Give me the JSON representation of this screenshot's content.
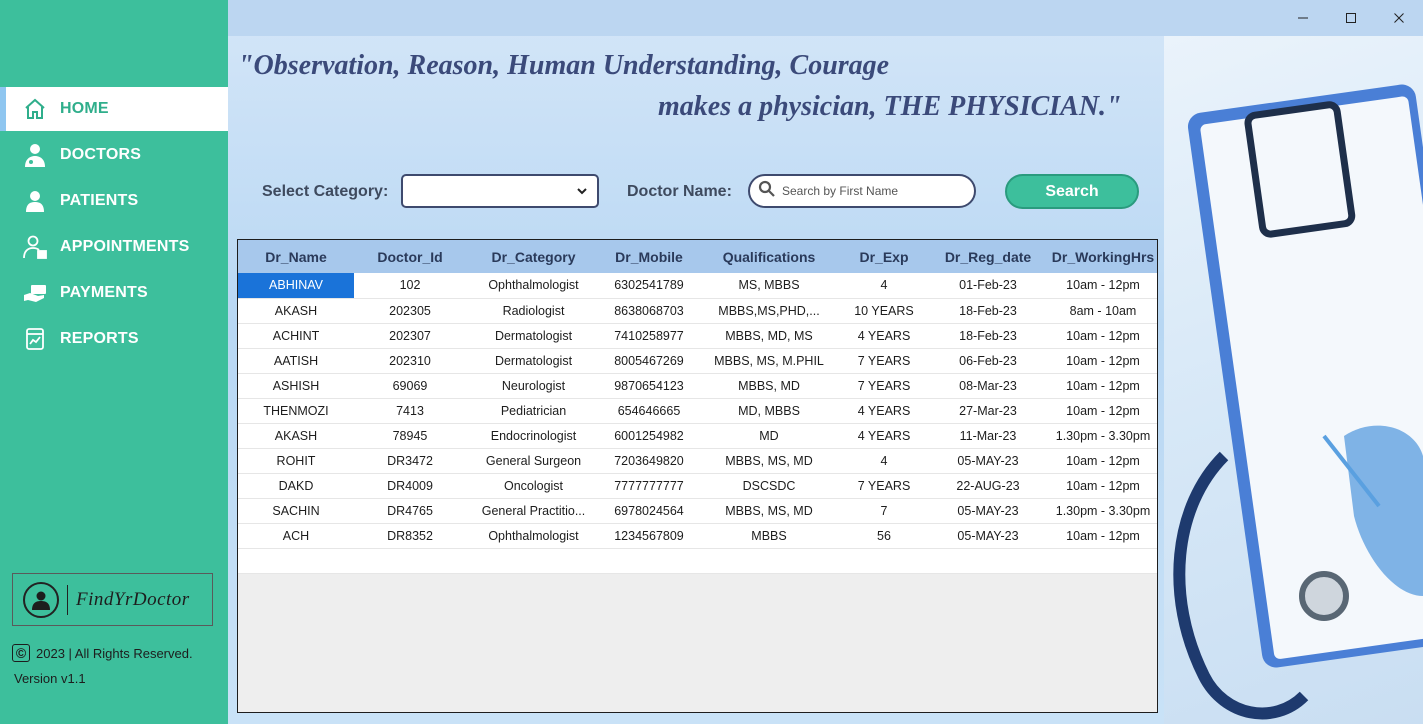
{
  "window": {
    "minimize_icon": "minimize-icon",
    "maximize_icon": "maximize-icon",
    "close_icon": "close-icon"
  },
  "sidebar": {
    "items": [
      {
        "label": "HOME",
        "icon": "home-icon",
        "active": true
      },
      {
        "label": "DOCTORS",
        "icon": "doctor-icon",
        "active": false
      },
      {
        "label": "PATIENTS",
        "icon": "patient-icon",
        "active": false
      },
      {
        "label": "APPOINTMENTS",
        "icon": "appointment-icon",
        "active": false
      },
      {
        "label": "PAYMENTS",
        "icon": "payment-icon",
        "active": false
      },
      {
        "label": "REPORTS",
        "icon": "report-icon",
        "active": false
      }
    ],
    "brand": "FindYrDoctor",
    "copyright": "2023 | All Rights Reserved.",
    "version": "Version v1.1"
  },
  "header": {
    "quote_line1": "\"Observation, Reason, Human Understanding, Courage",
    "quote_line2": "makes a physician, THE PHYSICIAN.\""
  },
  "filters": {
    "category_label": "Select Category:",
    "category_value": "",
    "doctor_name_label": "Doctor Name:",
    "search_placeholder": "Search by First Name",
    "search_value": "",
    "search_button": "Search"
  },
  "table": {
    "columns": [
      "Dr_Name",
      "Doctor_Id",
      "Dr_Category",
      "Dr_Mobile",
      "Qualifications",
      "Dr_Exp",
      "Dr_Reg_date",
      "Dr_WorkingHrs"
    ],
    "rows": [
      [
        "ABHINAV",
        "102",
        "Ophthalmologist",
        "6302541789",
        "MS, MBBS",
        "4",
        "01-Feb-23",
        "10am - 12pm"
      ],
      [
        "AKASH",
        "202305",
        "Radiologist",
        "8638068703",
        "MBBS,MS,PHD,...",
        "10 YEARS",
        "18-Feb-23",
        "8am - 10am"
      ],
      [
        "ACHINT",
        "202307",
        "Dermatologist",
        "7410258977",
        "MBBS, MD, MS",
        "4 YEARS",
        "18-Feb-23",
        "10am - 12pm"
      ],
      [
        "AATISH",
        "202310",
        "Dermatologist",
        "8005467269",
        "MBBS, MS, M.PHIL",
        "7 YEARS",
        "06-Feb-23",
        "10am - 12pm"
      ],
      [
        "ASHISH",
        "69069",
        "Neurologist",
        "9870654123",
        "MBBS, MD",
        "7 YEARS",
        "08-Mar-23",
        "10am - 12pm"
      ],
      [
        "THENMOZI",
        "7413",
        "Pediatrician",
        "654646665",
        "MD, MBBS",
        "4 YEARS",
        "27-Mar-23",
        "10am - 12pm"
      ],
      [
        "AKASH",
        "78945",
        "Endocrinologist",
        "6001254982",
        "MD",
        "4 YEARS",
        "11-Mar-23",
        "1.30pm - 3.30pm"
      ],
      [
        "ROHIT",
        "DR3472",
        "General Surgeon",
        "7203649820",
        "MBBS, MS, MD",
        "4",
        "05-MAY-23",
        "10am - 12pm"
      ],
      [
        "DAKD",
        "DR4009",
        "Oncologist",
        "7777777777",
        "DSCSDC",
        "7 YEARS",
        "22-AUG-23",
        "10am - 12pm"
      ],
      [
        "SACHIN",
        "DR4765",
        "General Practitio...",
        "6978024564",
        "MBBS, MS, MD",
        "7",
        "05-MAY-23",
        "1.30pm - 3.30pm"
      ],
      [
        "ACH",
        "DR8352",
        "Ophthalmologist",
        "1234567809",
        "MBBS",
        "56",
        "05-MAY-23",
        "10am - 12pm"
      ]
    ],
    "selected_cell": {
      "row": 0,
      "col": 0
    }
  },
  "colors": {
    "sidebar": "#3dbf9c",
    "header_row": "#a7c8ec",
    "selected": "#1a73d9",
    "quote_text": "#3b4a7a"
  }
}
